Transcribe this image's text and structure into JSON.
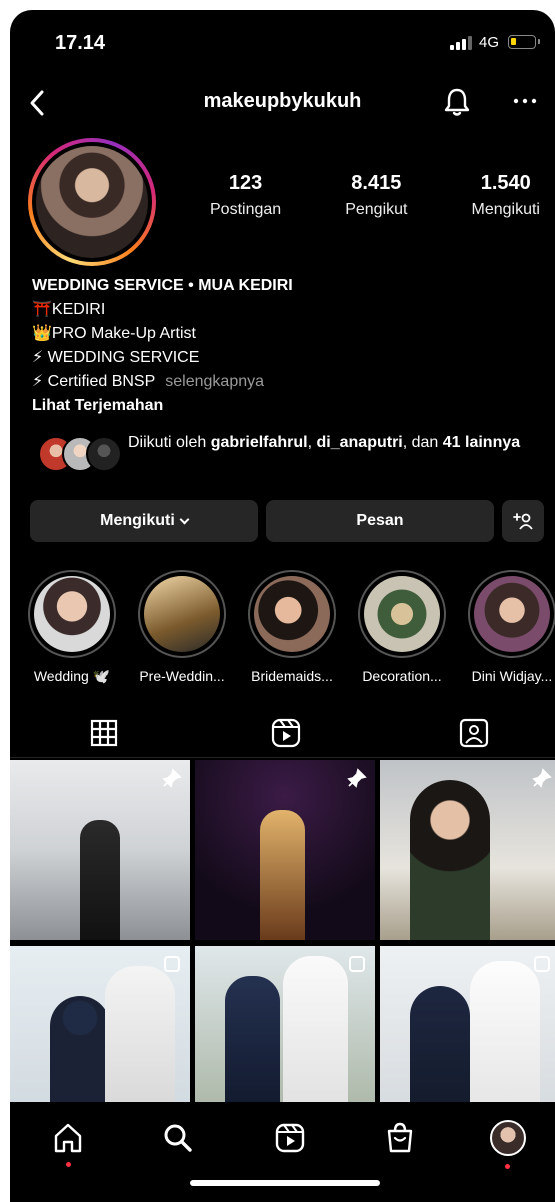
{
  "status_bar": {
    "time": "17.14",
    "network": "4G"
  },
  "header": {
    "username": "makeupbykukuh",
    "back_icon": "back-icon",
    "bell_icon": "bell-icon",
    "more_icon": "more-icon"
  },
  "profile": {
    "stats": [
      {
        "value": "123",
        "label": "Postingan"
      },
      {
        "value": "8.415",
        "label": "Pengikut"
      },
      {
        "value": "1.540",
        "label": "Mengikuti"
      }
    ],
    "bio": {
      "title": "WEDDING SERVICE • MUA KEDIRI",
      "lines": [
        "⛩️KEDIRI",
        "👑PRO Make-Up Artist",
        "⚡ WEDDING SERVICE",
        "⚡ Certified BNSP"
      ],
      "more": "selengkapnya",
      "translate": "Lihat Terjemahan"
    },
    "followed_by": {
      "prefix": "Diikuti oleh ",
      "user1": "gabrielfahrul",
      "sep": ", ",
      "user2": "di_anaputri",
      "mid": ", dan ",
      "rest": "41 lainnya"
    }
  },
  "buttons": {
    "following": "Mengikuti",
    "message": "Pesan",
    "add_user_icon": "+person-icon"
  },
  "highlights": [
    {
      "label": "Wedding 🕊️"
    },
    {
      "label": "Pre-Weddin..."
    },
    {
      "label": "Bridemaids..."
    },
    {
      "label": "Decoration..."
    },
    {
      "label": "Dini Widjay..."
    }
  ],
  "tabs": [
    "grid-icon",
    "reels-icon",
    "tagged-icon"
  ],
  "nav": [
    "home-icon",
    "search-icon",
    "reels-icon",
    "shop-icon",
    "profile-avatar"
  ],
  "colors": {
    "background": "#000000",
    "button": "#262626",
    "accent_red": "#ff3040",
    "battery": "#ffd60a"
  }
}
